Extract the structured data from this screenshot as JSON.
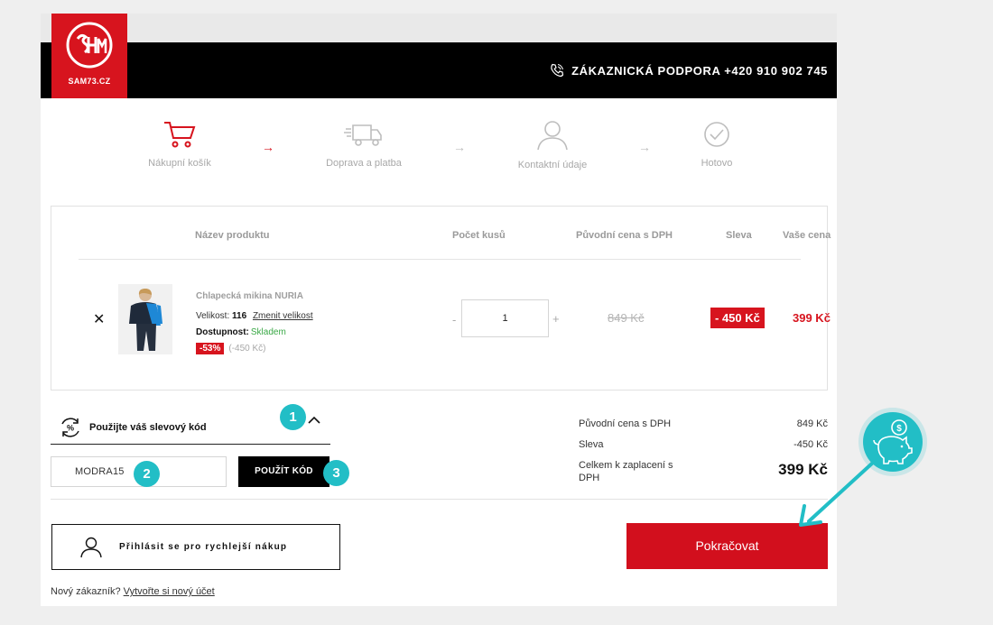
{
  "header": {
    "logo_text": "SAM73.CZ",
    "support_text": "ZÁKAZNICKÁ PODPORA +420 910 902 745"
  },
  "steps": [
    {
      "label": "Nákupní košík",
      "icon": "cart-icon",
      "active": true
    },
    {
      "label": "Doprava a platba",
      "icon": "truck-icon",
      "active": false
    },
    {
      "label": "Kontaktní údaje",
      "icon": "person-icon",
      "active": false
    },
    {
      "label": "Hotovo",
      "icon": "check-circle-icon",
      "active": false
    }
  ],
  "step_arrow": "→",
  "table": {
    "headers": [
      "Název produktu",
      "Počet kusů",
      "Původní cena s DPH",
      "Sleva",
      "Vaše cena"
    ]
  },
  "product": {
    "remove_label": "✕",
    "name": "Chlapecká mikina NURIA",
    "size_label": "Velikost:",
    "size_value": "116",
    "change_size": "Zmenit velikost",
    "availability_label": "Dostupnost:",
    "availability_value": "Skladem",
    "discount_badge": "-53%",
    "discount_amount": "(-450 Kč)",
    "quantity": "1",
    "minus": "-",
    "plus": "+",
    "original_price": "849 Kč",
    "discount": "- 450 Kč",
    "your_price": "399 Kč"
  },
  "coupon": {
    "toggle_label": "Použijte váš slevový kód",
    "code_value": "MODRA15",
    "apply_label": "POUŽÍT KÓD"
  },
  "summary": {
    "original_label": "Původní cena s DPH",
    "original_value": "849 Kč",
    "discount_label": "Sleva",
    "discount_value": "-450 Kč",
    "total_label": "Celkem k zaplacení s DPH",
    "total_value": "399 Kč"
  },
  "actions": {
    "login_label": "Přihlásit se pro rychlejší nákup",
    "continue_label": "Pokračovat",
    "new_customer_text": "Nový zákazník?",
    "new_customer_link": "Vytvořte si nový účet"
  },
  "annotations": {
    "markers": [
      "1",
      "2",
      "3"
    ],
    "coin_symbol": "$"
  },
  "colors": {
    "brand_red": "#d7141e",
    "annotation_teal": "#22bec6",
    "stock_green": "#39a845"
  }
}
